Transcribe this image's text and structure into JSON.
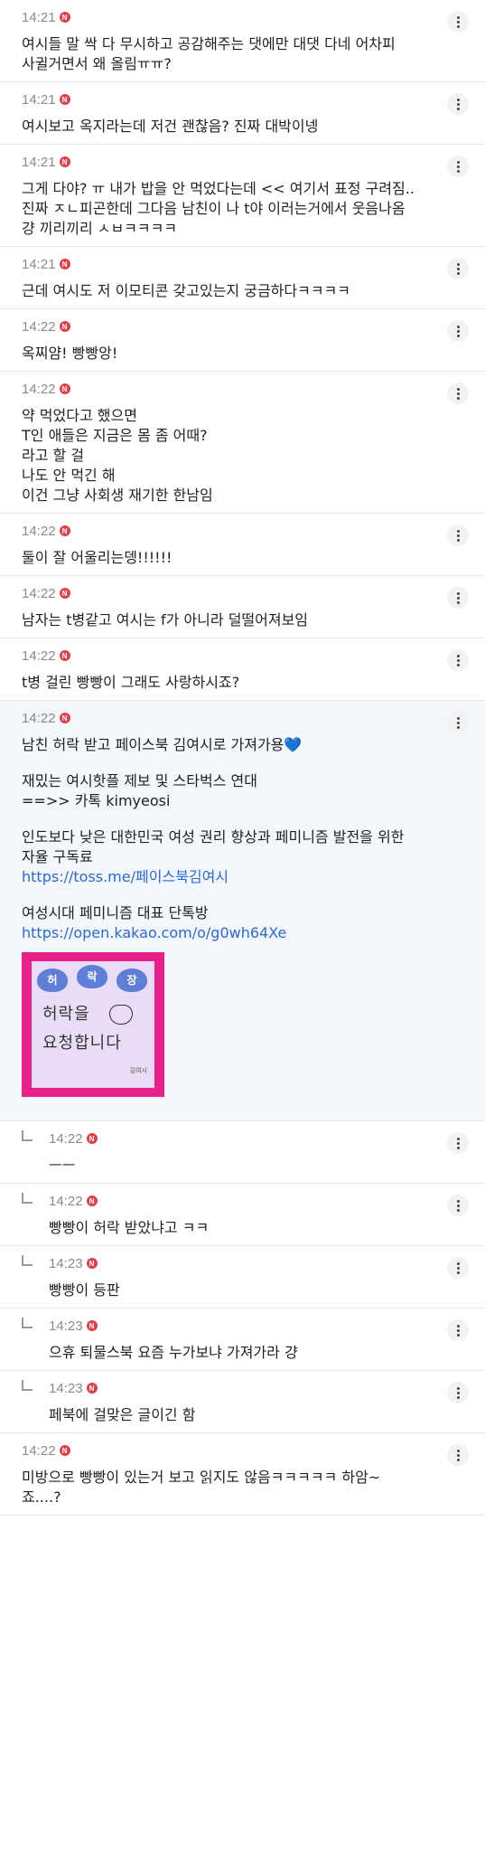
{
  "comments": [
    {
      "time": "14:21",
      "lines": [
        "여시들 말 싹 다 무시하고 공감해주는 댓에만 대댓 다네 어차피",
        "사귈거면서 왜 올림ㅠㅠ?"
      ]
    },
    {
      "time": "14:21",
      "lines": [
        "여시보고 옥지라는데 저건 괜찮음? 진짜 대박이넹"
      ]
    },
    {
      "time": "14:21",
      "lines": [
        "그게 다야? ㅠ 내가 밥을 안 먹었다는데 << 여기서 표정 구려짐..",
        "진짜 ㅈㄴ피곤한데 그다음 남친이 나 t야 이러는거에서 웃음나옴",
        "걍 끼리끼리 ㅅㅂㅋㅋㅋㅋ"
      ]
    },
    {
      "time": "14:21",
      "lines": [
        "근데 여시도 저 이모티콘 갖고있는지 궁금하다ㅋㅋㅋㅋ"
      ]
    },
    {
      "time": "14:22",
      "lines": [
        "옥찌얌! 빵빵앙!"
      ]
    },
    {
      "time": "14:22",
      "lines": [
        "약 먹었다고 했으면",
        "T인 애들은 지금은 몸 좀 어때?",
        "라고 할 걸",
        "나도 안 먹긴 해",
        "이건 그냥 사회생 재기한 한남임"
      ]
    },
    {
      "time": "14:22",
      "lines": [
        "둘이 잘 어울리는뎅!!!!!!"
      ]
    },
    {
      "time": "14:22",
      "lines": [
        "남자는 t병같고 여시는 f가 아니라 덜떨어져보임"
      ]
    },
    {
      "time": "14:22",
      "lines": [
        "t병 걸린 빵빵이 그래도 사랑하시죠?"
      ]
    }
  ],
  "highlight": {
    "time": "14:22",
    "line1": "남친 허락 받고 페이스북 김여시로 가져가용💙",
    "line2": "재밌는 여시핫플 제보 및 스타벅스 연대",
    "line3": "==>> 카톡 kimyeosi",
    "line4": "인도보다 낮은 대한민국 여성 권리 향상과 페미니즘 발전을 위한",
    "line5": "자율 구독료",
    "link1": "https://toss.me/페이스북김여시",
    "line6": "여성시대 페미니즘 대표 단톡방",
    "link2": "https://open.kakao.com/o/g0wh64Xe",
    "banner": {
      "heart1": "허",
      "heart2": "락",
      "heart3": "장",
      "text1": "허락을",
      "text2": "요청합니다",
      "side": "허락",
      "sig": "김여시",
      "bg_color": "#e8218a"
    }
  },
  "replies": [
    {
      "time": "14:22",
      "text": "ㅡㅡ"
    },
    {
      "time": "14:22",
      "text": "빵빵이 허락 받았냐고 ㅋㅋ"
    },
    {
      "time": "14:23",
      "text": "빵빵이 등판"
    },
    {
      "time": "14:23",
      "text": "으휴 퇴물스북 요즘 누가보냐 가져가라 걍"
    },
    {
      "time": "14:23",
      "text": "페북에 걸맞은 글이긴 함"
    }
  ],
  "last": {
    "time": "14:22",
    "lines": [
      "미방으로 빵빵이 있는거 보고 읽지도 않음ㅋㅋㅋㅋㅋ 하암~",
      "죠....?"
    ]
  },
  "badge": "N",
  "icons": {
    "more": "more-vertical-icon",
    "reply": "reply-arrow-icon",
    "badge": "new-badge-icon"
  },
  "colors": {
    "badge": "#e0404a",
    "link": "#2a6ad6",
    "highlight_bg": "#f3f6fa"
  }
}
